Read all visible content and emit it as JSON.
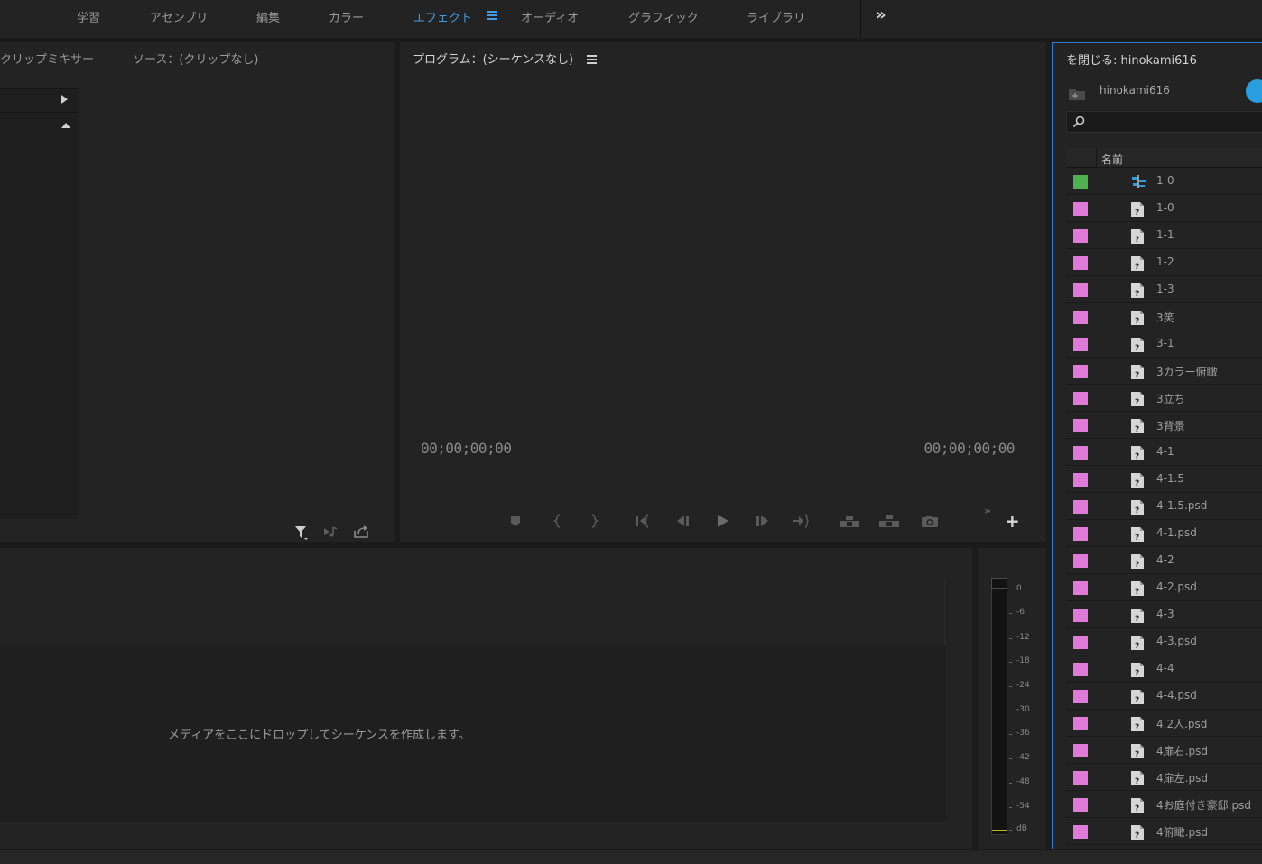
{
  "workspace": {
    "tabs": [
      {
        "label": "学習"
      },
      {
        "label": "アセンブリ"
      },
      {
        "label": "編集"
      },
      {
        "label": "カラー"
      },
      {
        "label": "エフェクト",
        "active": true
      },
      {
        "label": "オーディオ"
      },
      {
        "label": "グラフィック"
      },
      {
        "label": "ライブラリ"
      }
    ],
    "overflow": "»"
  },
  "source": {
    "tab_mixer": "クリップミキサー",
    "tab_source": "ソース：(クリップなし)"
  },
  "program": {
    "tab": "プログラム：(シーケンスなし)",
    "timecode_left": "00;00;00;00",
    "timecode_right": "00;00;00;00",
    "overflow": "»",
    "add": "+"
  },
  "timeline": {
    "drop_hint": "メディアをここにドロップしてシーケンスを作成します。"
  },
  "meter": {
    "labels": [
      "0",
      "-6",
      "-12",
      "-18",
      "-24",
      "-30",
      "-36",
      "-42",
      "-48",
      "-54",
      "dB"
    ]
  },
  "project": {
    "tab": "を閉じる: hinokami616",
    "name": "hinokami616",
    "search_placeholder": "",
    "column_name": "名前",
    "colors": {
      "sequence": "#4fb04f",
      "still": "#e07ad9",
      "accent": "#2e7fd6"
    },
    "items": [
      {
        "label": "1-0",
        "type": "sequence"
      },
      {
        "label": "1-0",
        "type": "still"
      },
      {
        "label": "1-1",
        "type": "still"
      },
      {
        "label": "1-2",
        "type": "still"
      },
      {
        "label": "1-3",
        "type": "still"
      },
      {
        "label": "3笑",
        "type": "still"
      },
      {
        "label": "3-1",
        "type": "still"
      },
      {
        "label": "3カラー俯瞰",
        "type": "still"
      },
      {
        "label": "3立ち",
        "type": "still"
      },
      {
        "label": "3背景",
        "type": "still"
      },
      {
        "label": "4-1",
        "type": "still"
      },
      {
        "label": "4-1.5",
        "type": "still"
      },
      {
        "label": "4-1.5.psd",
        "type": "still"
      },
      {
        "label": "4-1.psd",
        "type": "still"
      },
      {
        "label": "4-2",
        "type": "still"
      },
      {
        "label": "4-2.psd",
        "type": "still"
      },
      {
        "label": "4-3",
        "type": "still"
      },
      {
        "label": "4-3.psd",
        "type": "still"
      },
      {
        "label": "4-4",
        "type": "still"
      },
      {
        "label": "4-4.psd",
        "type": "still"
      },
      {
        "label": "4.2人.psd",
        "type": "still"
      },
      {
        "label": "4扉右.psd",
        "type": "still"
      },
      {
        "label": "4扉左.psd",
        "type": "still"
      },
      {
        "label": "4お庭付き豪邸.psd",
        "type": "still"
      },
      {
        "label": "4俯瞰.psd",
        "type": "still"
      }
    ]
  }
}
